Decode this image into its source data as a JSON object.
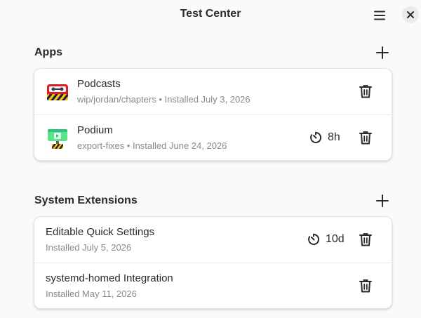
{
  "window": {
    "title": "Test Center"
  },
  "sections": {
    "apps": {
      "title": "Apps",
      "items": [
        {
          "name": "Podcasts",
          "subtitle": "wip/jordan/chapters • Installed July 3, 2026",
          "icon": "podcasts-app-icon",
          "timer": ""
        },
        {
          "name": "Podium",
          "subtitle": "export-fixes • Installed June 24, 2026",
          "icon": "podium-app-icon",
          "timer": "8h"
        }
      ]
    },
    "extensions": {
      "title": "System Extensions",
      "items": [
        {
          "name": "Editable Quick Settings",
          "subtitle": "Installed July 5, 2026",
          "timer": "10d"
        },
        {
          "name": "systemd-homed Integration",
          "subtitle": "Installed May 11, 2026",
          "timer": ""
        }
      ]
    }
  },
  "icons": {
    "menu": "hamburger-menu-icon",
    "close": "close-icon",
    "add": "plus-icon",
    "trash": "trash-icon",
    "timer": "timer-icon"
  },
  "colors": {
    "background": "#fafafb",
    "card": "#ffffff",
    "text": "#2b2b2f",
    "subtext": "#8a8a90",
    "warning_yellow": "#f5c211",
    "podcasts_red": "#e01b24",
    "podium_green": "#57e389"
  }
}
